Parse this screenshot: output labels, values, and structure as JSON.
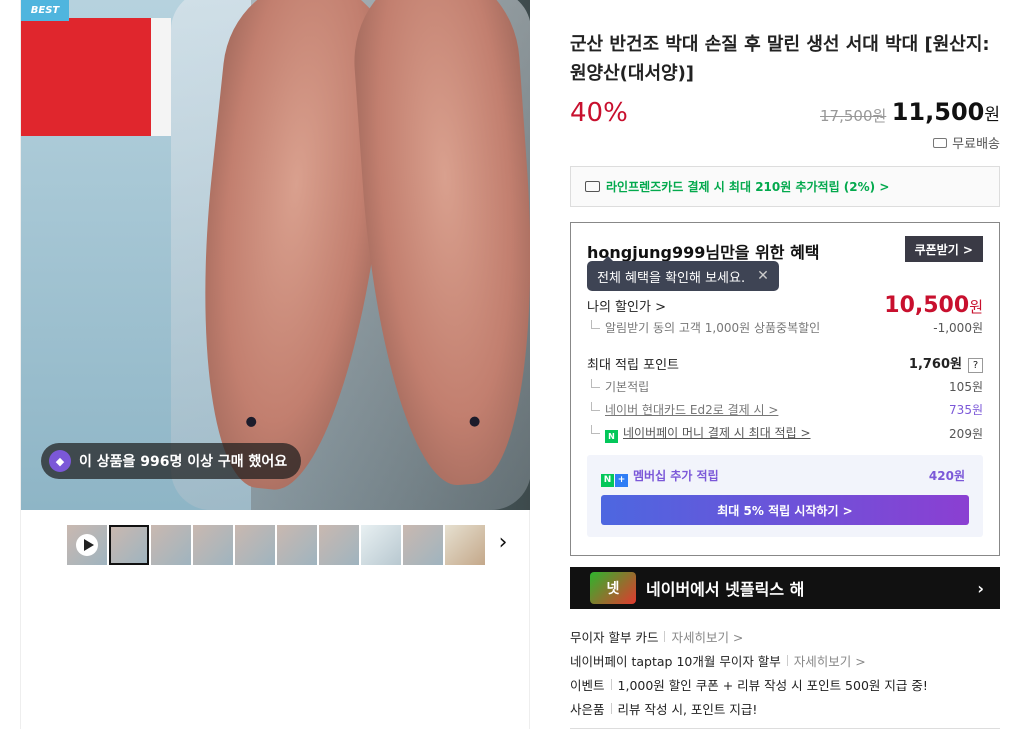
{
  "gallery": {
    "badge": "BEST",
    "purchase_notice": "이 상품을 996명 이상 구매 했어요",
    "thumb_count": 10
  },
  "product": {
    "title": "군산 반건조 박대 손질 후 말린 생선 서대 박대 [원산지:원양산(대서양)]",
    "discount": "40%",
    "original_price": "17,500원",
    "sale_price": "11,500",
    "sale_price_unit": "원",
    "shipping": "무료배송"
  },
  "card_banner": {
    "text": "라인프렌즈카드 결제 시 최대 210원 추가적립 (2%) >"
  },
  "benefits": {
    "title": "hongjung999님만을 위한 혜택",
    "coupon_button": "쿠폰받기 >",
    "tooltip": "전체 혜택을 확인해 보세요.",
    "tooltip_close": "✕",
    "my_price_label": "나의 할인가 >",
    "my_price": "10,500",
    "my_price_unit": "원",
    "my_price_detail_label": "알림받기 동의 고객 1,000원 상품중복할인",
    "my_price_detail_value": "-1,000원",
    "points_label": "최대 적립 포인트",
    "points_value": "1,760원",
    "help": "?",
    "points_items": [
      {
        "label": "기본적립",
        "value": "105원"
      },
      {
        "label": "네이버 현대카드 Ed2로 결제 시 >",
        "value": "735원"
      },
      {
        "label": "네이버페이 머니 결제 시 최대 적립 >",
        "value": "209원"
      }
    ],
    "member_label": "멤버십 추가 적립",
    "member_value": "420원",
    "member_button": "최대 5% 적립 시작하기 >"
  },
  "netflix_banner": {
    "logo": "넷",
    "text": "네이버에서 넷플릭스 해",
    "arrow": "›"
  },
  "info_list": [
    {
      "label": "무이자 할부 카드",
      "more": "자세히보기 >"
    },
    {
      "label": "네이버페이 taptap 10개월 무이자 할부",
      "more": "자세히보기 >"
    },
    {
      "label": "이벤트",
      "more": "1,000원 할인 쿠폰 + 리뷰 작성 시 포인트 500원 지급 중!"
    },
    {
      "label": "사은품",
      "more": "리뷰 작성 시, 포인트 지급!"
    }
  ],
  "colors": {
    "discount_red": "#c8102e",
    "naver_green": "#03c75a",
    "purple": "#7b58d8"
  }
}
